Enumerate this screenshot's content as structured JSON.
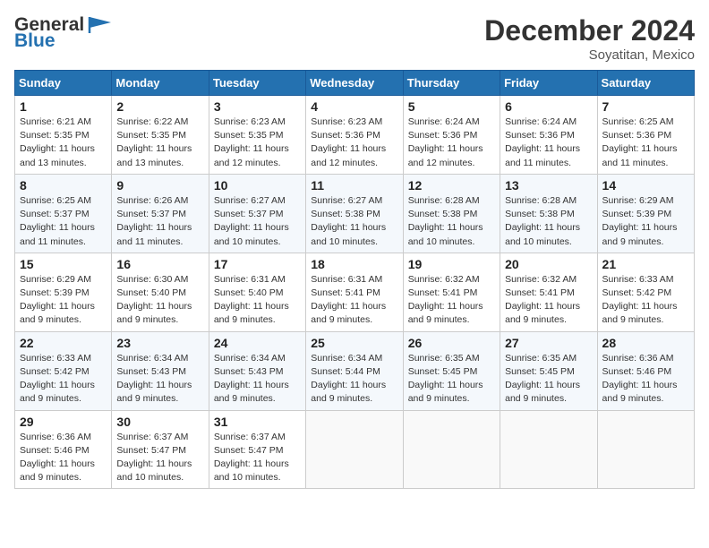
{
  "header": {
    "logo_line1": "General",
    "logo_line2": "Blue",
    "month": "December 2024",
    "location": "Soyatitan, Mexico"
  },
  "weekdays": [
    "Sunday",
    "Monday",
    "Tuesday",
    "Wednesday",
    "Thursday",
    "Friday",
    "Saturday"
  ],
  "weeks": [
    [
      {
        "day": "1",
        "info": "Sunrise: 6:21 AM\nSunset: 5:35 PM\nDaylight: 11 hours\nand 13 minutes."
      },
      {
        "day": "2",
        "info": "Sunrise: 6:22 AM\nSunset: 5:35 PM\nDaylight: 11 hours\nand 13 minutes."
      },
      {
        "day": "3",
        "info": "Sunrise: 6:23 AM\nSunset: 5:35 PM\nDaylight: 11 hours\nand 12 minutes."
      },
      {
        "day": "4",
        "info": "Sunrise: 6:23 AM\nSunset: 5:36 PM\nDaylight: 11 hours\nand 12 minutes."
      },
      {
        "day": "5",
        "info": "Sunrise: 6:24 AM\nSunset: 5:36 PM\nDaylight: 11 hours\nand 12 minutes."
      },
      {
        "day": "6",
        "info": "Sunrise: 6:24 AM\nSunset: 5:36 PM\nDaylight: 11 hours\nand 11 minutes."
      },
      {
        "day": "7",
        "info": "Sunrise: 6:25 AM\nSunset: 5:36 PM\nDaylight: 11 hours\nand 11 minutes."
      }
    ],
    [
      {
        "day": "8",
        "info": "Sunrise: 6:25 AM\nSunset: 5:37 PM\nDaylight: 11 hours\nand 11 minutes."
      },
      {
        "day": "9",
        "info": "Sunrise: 6:26 AM\nSunset: 5:37 PM\nDaylight: 11 hours\nand 11 minutes."
      },
      {
        "day": "10",
        "info": "Sunrise: 6:27 AM\nSunset: 5:37 PM\nDaylight: 11 hours\nand 10 minutes."
      },
      {
        "day": "11",
        "info": "Sunrise: 6:27 AM\nSunset: 5:38 PM\nDaylight: 11 hours\nand 10 minutes."
      },
      {
        "day": "12",
        "info": "Sunrise: 6:28 AM\nSunset: 5:38 PM\nDaylight: 11 hours\nand 10 minutes."
      },
      {
        "day": "13",
        "info": "Sunrise: 6:28 AM\nSunset: 5:38 PM\nDaylight: 11 hours\nand 10 minutes."
      },
      {
        "day": "14",
        "info": "Sunrise: 6:29 AM\nSunset: 5:39 PM\nDaylight: 11 hours\nand 9 minutes."
      }
    ],
    [
      {
        "day": "15",
        "info": "Sunrise: 6:29 AM\nSunset: 5:39 PM\nDaylight: 11 hours\nand 9 minutes."
      },
      {
        "day": "16",
        "info": "Sunrise: 6:30 AM\nSunset: 5:40 PM\nDaylight: 11 hours\nand 9 minutes."
      },
      {
        "day": "17",
        "info": "Sunrise: 6:31 AM\nSunset: 5:40 PM\nDaylight: 11 hours\nand 9 minutes."
      },
      {
        "day": "18",
        "info": "Sunrise: 6:31 AM\nSunset: 5:41 PM\nDaylight: 11 hours\nand 9 minutes."
      },
      {
        "day": "19",
        "info": "Sunrise: 6:32 AM\nSunset: 5:41 PM\nDaylight: 11 hours\nand 9 minutes."
      },
      {
        "day": "20",
        "info": "Sunrise: 6:32 AM\nSunset: 5:41 PM\nDaylight: 11 hours\nand 9 minutes."
      },
      {
        "day": "21",
        "info": "Sunrise: 6:33 AM\nSunset: 5:42 PM\nDaylight: 11 hours\nand 9 minutes."
      }
    ],
    [
      {
        "day": "22",
        "info": "Sunrise: 6:33 AM\nSunset: 5:42 PM\nDaylight: 11 hours\nand 9 minutes."
      },
      {
        "day": "23",
        "info": "Sunrise: 6:34 AM\nSunset: 5:43 PM\nDaylight: 11 hours\nand 9 minutes."
      },
      {
        "day": "24",
        "info": "Sunrise: 6:34 AM\nSunset: 5:43 PM\nDaylight: 11 hours\nand 9 minutes."
      },
      {
        "day": "25",
        "info": "Sunrise: 6:34 AM\nSunset: 5:44 PM\nDaylight: 11 hours\nand 9 minutes."
      },
      {
        "day": "26",
        "info": "Sunrise: 6:35 AM\nSunset: 5:45 PM\nDaylight: 11 hours\nand 9 minutes."
      },
      {
        "day": "27",
        "info": "Sunrise: 6:35 AM\nSunset: 5:45 PM\nDaylight: 11 hours\nand 9 minutes."
      },
      {
        "day": "28",
        "info": "Sunrise: 6:36 AM\nSunset: 5:46 PM\nDaylight: 11 hours\nand 9 minutes."
      }
    ],
    [
      {
        "day": "29",
        "info": "Sunrise: 6:36 AM\nSunset: 5:46 PM\nDaylight: 11 hours\nand 9 minutes."
      },
      {
        "day": "30",
        "info": "Sunrise: 6:37 AM\nSunset: 5:47 PM\nDaylight: 11 hours\nand 10 minutes."
      },
      {
        "day": "31",
        "info": "Sunrise: 6:37 AM\nSunset: 5:47 PM\nDaylight: 11 hours\nand 10 minutes."
      },
      null,
      null,
      null,
      null
    ]
  ]
}
